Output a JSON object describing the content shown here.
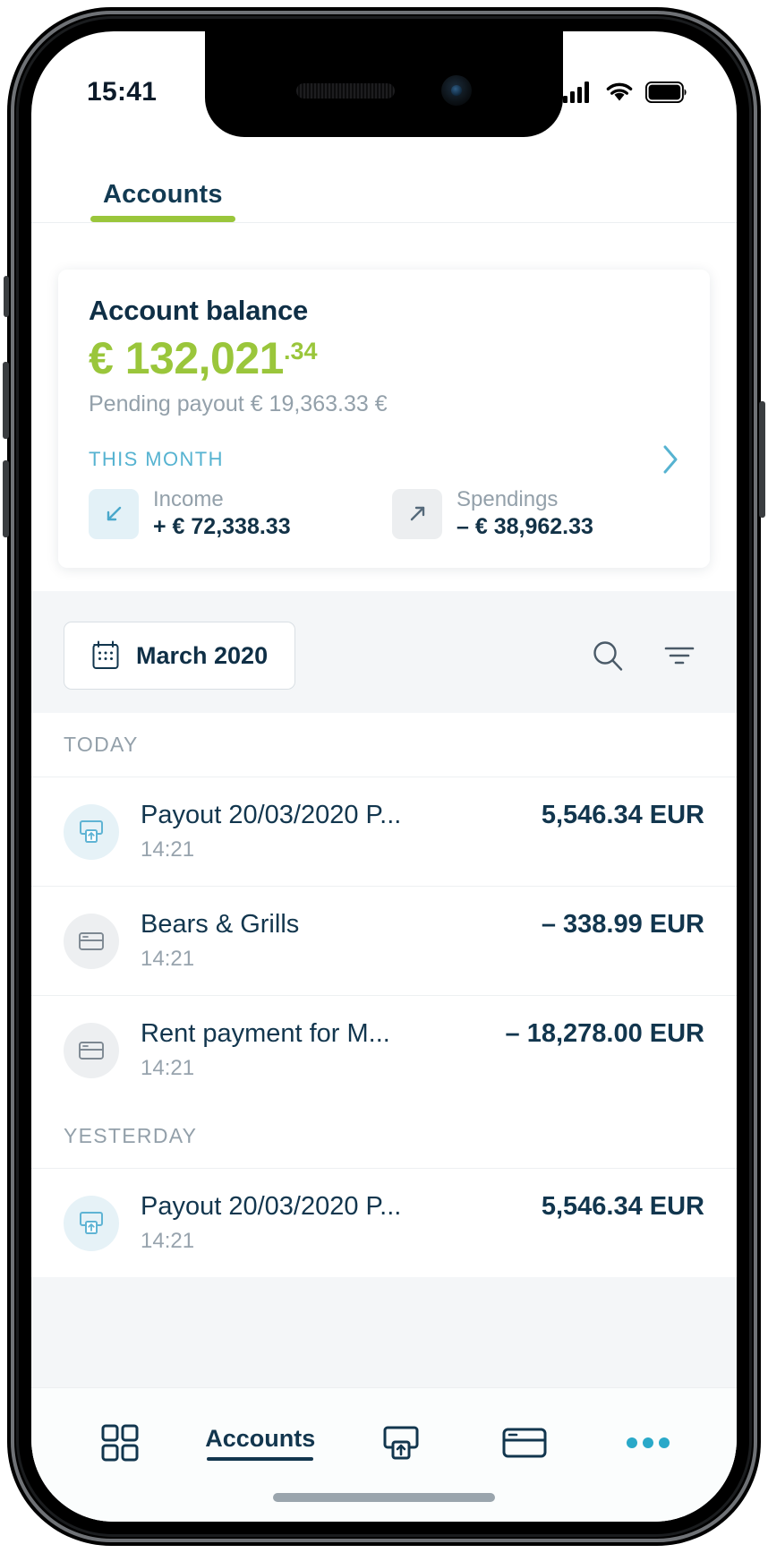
{
  "status_bar": {
    "time": "15:41",
    "signal_icon": "cellular-signal-icon",
    "wifi_icon": "wifi-icon",
    "battery_icon": "battery-icon"
  },
  "top_tabs": [
    {
      "label": "Accounts",
      "active": true
    }
  ],
  "balance_card": {
    "title": "Account balance",
    "amount": "€ 132,021",
    "cents": ".34",
    "amount_color": "#9ac63b",
    "pending_payout": "Pending payout € 19,363.33 €",
    "this_month_label": "THIS MONTH",
    "chevron_icon": "chevron-right-icon",
    "metrics": [
      {
        "label": "Income",
        "value": "+ € 72,338.33",
        "icon": "arrow-down-left-icon",
        "icon_bg": "#e3f1f7"
      },
      {
        "label": "Spendings",
        "value": "– € 38,962.33",
        "icon": "arrow-up-right-icon",
        "icon_bg": "#eceef0"
      }
    ]
  },
  "filter_row": {
    "month_label": "March 2020",
    "calendar_icon": "calendar-icon",
    "search_icon": "search-icon",
    "filter_icon": "filter-icon"
  },
  "transactions": {
    "groups": [
      {
        "header": "TODAY",
        "rows": [
          {
            "title": "Payout 20/03/2020 P...",
            "amount": "5,546.34 EUR",
            "time": "14:21",
            "icon": "payout-icon",
            "icon_type": "payout"
          },
          {
            "title": "Bears & Grills",
            "amount": "– 338.99 EUR",
            "time": "14:21",
            "icon": "card-icon",
            "icon_type": "card"
          },
          {
            "title": "Rent payment for M...",
            "amount": "– 18,278.00 EUR",
            "time": "14:21",
            "icon": "card-icon",
            "icon_type": "card"
          }
        ]
      },
      {
        "header": "YESTERDAY",
        "rows": [
          {
            "title": "Payout 20/03/2020 P...",
            "amount": "5,546.34 EUR",
            "time": "14:21",
            "icon": "payout-icon",
            "icon_type": "payout"
          }
        ]
      }
    ]
  },
  "bottom_bar": {
    "items": [
      {
        "icon": "dashboard-grid-icon",
        "label": "",
        "active": false
      },
      {
        "icon": "",
        "label": "Accounts",
        "active": true
      },
      {
        "icon": "payout-icon",
        "label": "",
        "active": false
      },
      {
        "icon": "card-icon",
        "label": "",
        "active": false
      },
      {
        "icon": "more-dots-icon",
        "label": "",
        "active": false
      }
    ],
    "accent_color": "#12364e",
    "more_dots_color": "#2aa9c9"
  }
}
